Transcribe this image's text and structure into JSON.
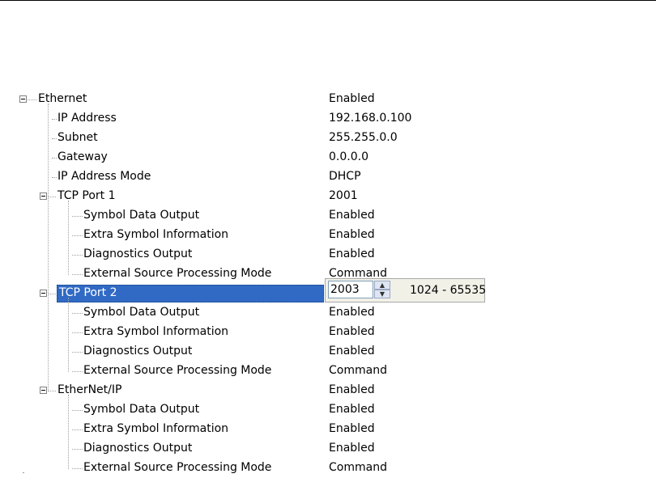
{
  "tree": [
    {
      "label": "Ethernet",
      "value": "Enabled",
      "level": 0,
      "expander": true
    },
    {
      "label": "IP Address",
      "value": "192.168.0.100",
      "level": 1
    },
    {
      "label": "Subnet",
      "value": "255.255.0.0",
      "level": 1
    },
    {
      "label": "Gateway",
      "value": "0.0.0.0",
      "level": 1
    },
    {
      "label": "IP Address Mode",
      "value": "DHCP",
      "level": 1
    },
    {
      "label": "TCP Port 1",
      "value": "2001",
      "level": 1,
      "expander": true
    },
    {
      "label": "Symbol Data Output",
      "value": "Enabled",
      "level": 2
    },
    {
      "label": "Extra Symbol Information",
      "value": "Enabled",
      "level": 2
    },
    {
      "label": "Diagnostics Output",
      "value": "Enabled",
      "level": 2
    },
    {
      "label": "External Source Processing Mode",
      "value": "Command",
      "level": 2
    },
    {
      "label": "TCP Port 2",
      "value": "",
      "level": 1,
      "expander": true,
      "selected": true
    },
    {
      "label": "Symbol Data Output",
      "value": "Enabled",
      "level": 2
    },
    {
      "label": "Extra Symbol Information",
      "value": "Enabled",
      "level": 2
    },
    {
      "label": "Diagnostics Output",
      "value": "Enabled",
      "level": 2
    },
    {
      "label": "External Source Processing Mode",
      "value": "Command",
      "level": 2
    },
    {
      "label": "EtherNet/IP",
      "value": "Enabled",
      "level": 1,
      "expander": true
    },
    {
      "label": "Symbol Data Output",
      "value": "Enabled",
      "level": 2
    },
    {
      "label": "Extra Symbol Information",
      "value": "Enabled",
      "level": 2
    },
    {
      "label": "Diagnostics Output",
      "value": "Enabled",
      "level": 2
    },
    {
      "label": "External Source Processing Mode",
      "value": "Command",
      "level": 2
    }
  ],
  "editor": {
    "value": "2003",
    "range": "1024 - 65535"
  },
  "colors": {
    "selection": "#316ac5"
  }
}
